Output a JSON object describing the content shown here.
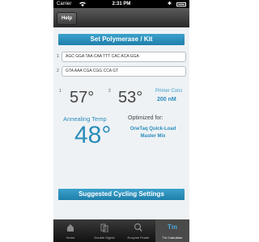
{
  "status_bar": {
    "carrier": "Carrier",
    "time": "2:31 PM"
  },
  "nav": {
    "help_label": "Help"
  },
  "set_polymerase": {
    "label": "Set Polymerase / Kit"
  },
  "primers": [
    {
      "number": "1",
      "sequence": "AGC GGA TAA CAA TTT CAC ACA GGA"
    },
    {
      "number": "2",
      "sequence": "GTA AAA CGA CGG CCA GT"
    }
  ],
  "tm": [
    {
      "number": "1",
      "value": "57°"
    },
    {
      "number": "2",
      "value": "53°"
    }
  ],
  "primer_conc": {
    "label": "Primer Conc",
    "value": "200 nM"
  },
  "annealing": {
    "label": "Annealing Temp",
    "value": "48°"
  },
  "optimized": {
    "label": "Optimized for:",
    "value": "OneTaq Quick-Load Master Mix"
  },
  "suggested_cycling": {
    "label": "Suggested Cycling Settings"
  },
  "tabs": [
    {
      "label": "Home",
      "icon": "home-icon"
    },
    {
      "label": "Double Digest",
      "icon": "double-digest-icon"
    },
    {
      "label": "Enzyme Finder",
      "icon": "search-icon"
    },
    {
      "label": "Tm Calculator",
      "icon": "tm-icon",
      "glyph": "Tm",
      "active": true
    }
  ],
  "colors": {
    "accent": "#2a8cba",
    "button": "#2f92bd",
    "background": "#eef2f5"
  }
}
